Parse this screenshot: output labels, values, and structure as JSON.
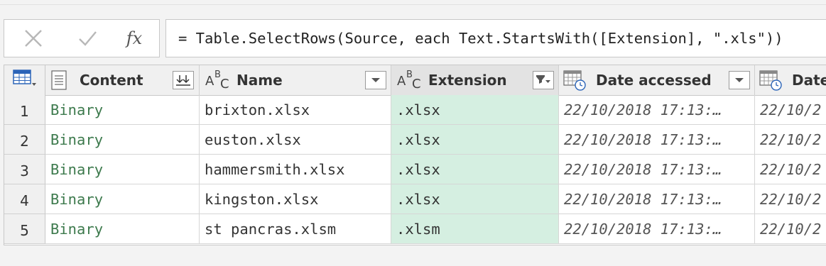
{
  "formula_bar": {
    "cancel_icon": "close-icon",
    "commit_icon": "check-icon",
    "fx_label": "fx",
    "formula": "= Table.SelectRows(Source, each Text.StartsWith([Extension], \".xls\"))"
  },
  "table": {
    "corner_icon": "table-icon",
    "columns": [
      {
        "key": "content",
        "label": "Content",
        "type_icon": "binary-icon",
        "button_icon": "expand-icon"
      },
      {
        "key": "name",
        "label": "Name",
        "type_icon": "text-type-icon",
        "button_icon": "chevron-down-icon"
      },
      {
        "key": "extension",
        "label": "Extension",
        "type_icon": "text-type-icon",
        "button_icon": "filter-icon",
        "selected": true
      },
      {
        "key": "date_accessed",
        "label": "Date accessed",
        "type_icon": "datetime-type-icon",
        "button_icon": "chevron-down-icon"
      },
      {
        "key": "date_next",
        "label": "Date",
        "type_icon": "datetime-type-icon"
      }
    ],
    "rows": [
      {
        "num": "1",
        "content": "Binary",
        "name": "brixton.xlsx",
        "extension": ".xlsx",
        "date_accessed": "22/10/2018 17:13:…",
        "date_next": "22/10/2"
      },
      {
        "num": "2",
        "content": "Binary",
        "name": "euston.xlsx",
        "extension": ".xlsx",
        "date_accessed": "22/10/2018 17:13:…",
        "date_next": "22/10/2"
      },
      {
        "num": "3",
        "content": "Binary",
        "name": "hammersmith.xlsx",
        "extension": ".xlsx",
        "date_accessed": "22/10/2018 17:13:…",
        "date_next": "22/10/2"
      },
      {
        "num": "4",
        "content": "Binary",
        "name": "kingston.xlsx",
        "extension": ".xlsx",
        "date_accessed": "22/10/2018 17:13:…",
        "date_next": "22/10/2"
      },
      {
        "num": "5",
        "content": "Binary",
        "name": "st pancras.xlsm",
        "extension": ".xlsm",
        "date_accessed": "22/10/2018 17:13:…",
        "date_next": "22/10/2"
      }
    ]
  },
  "colors": {
    "selected_column_fill": "#d5efe1",
    "binary_text": "#3d7a4d",
    "header_fill": "#f0f0f0"
  }
}
